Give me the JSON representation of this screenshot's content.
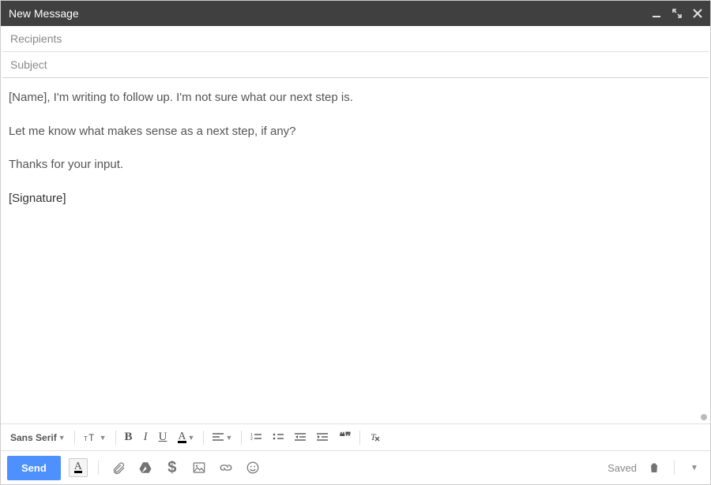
{
  "titlebar": {
    "title": "New Message"
  },
  "fields": {
    "recipients_placeholder": "Recipients",
    "subject_placeholder": "Subject"
  },
  "body": {
    "p1": "[Name], I'm writing to follow up. I'm not sure what our next step is.",
    "p2": "Let me know what makes sense as a next step, if any?",
    "p3": "Thanks for your input.",
    "p4": "[Signature]"
  },
  "format_toolbar": {
    "font_family": "Sans Serif",
    "bold": "B",
    "italic": "I",
    "underline": "U",
    "text_color_letter": "A",
    "quote": "❝❞"
  },
  "action_bar": {
    "send": "Send",
    "saved": "Saved"
  }
}
